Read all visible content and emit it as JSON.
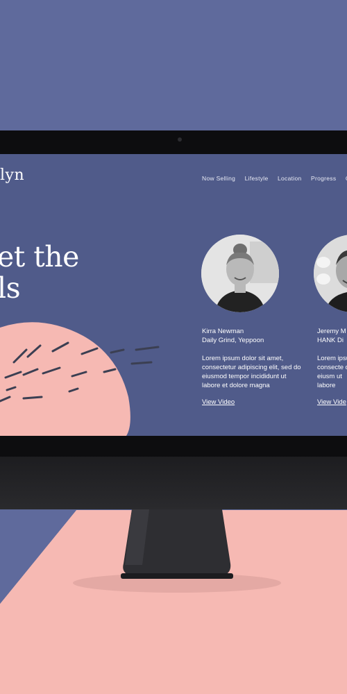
{
  "site": {
    "logo_text": "lyn",
    "nav": [
      {
        "label": "Now Selling"
      },
      {
        "label": "Lifestyle"
      },
      {
        "label": "Location"
      },
      {
        "label": "Progress"
      },
      {
        "label": "Co"
      }
    ],
    "headline": {
      "line1": "et the",
      "line2": "ls"
    }
  },
  "people": [
    {
      "name": "Kirra Newman",
      "place": "Daily Grind,  Yeppoon",
      "description": "Lorem ipsum dolor sit amet, consectetur adipiscing elit, sed do eiusmod tempor incididunt ut labore et dolore magna",
      "link": "View Video"
    },
    {
      "name": "Jeremy M",
      "place": "HANK Di",
      "description": "Lorem ipsu consecte do eiusm ut labore",
      "link": "View Vide"
    }
  ],
  "colors": {
    "background_blue": "#5f6a9c",
    "screen_blue": "#505b8a",
    "accent_pink": "#f6b9b3",
    "monitor_black": "#0d0d0f"
  }
}
